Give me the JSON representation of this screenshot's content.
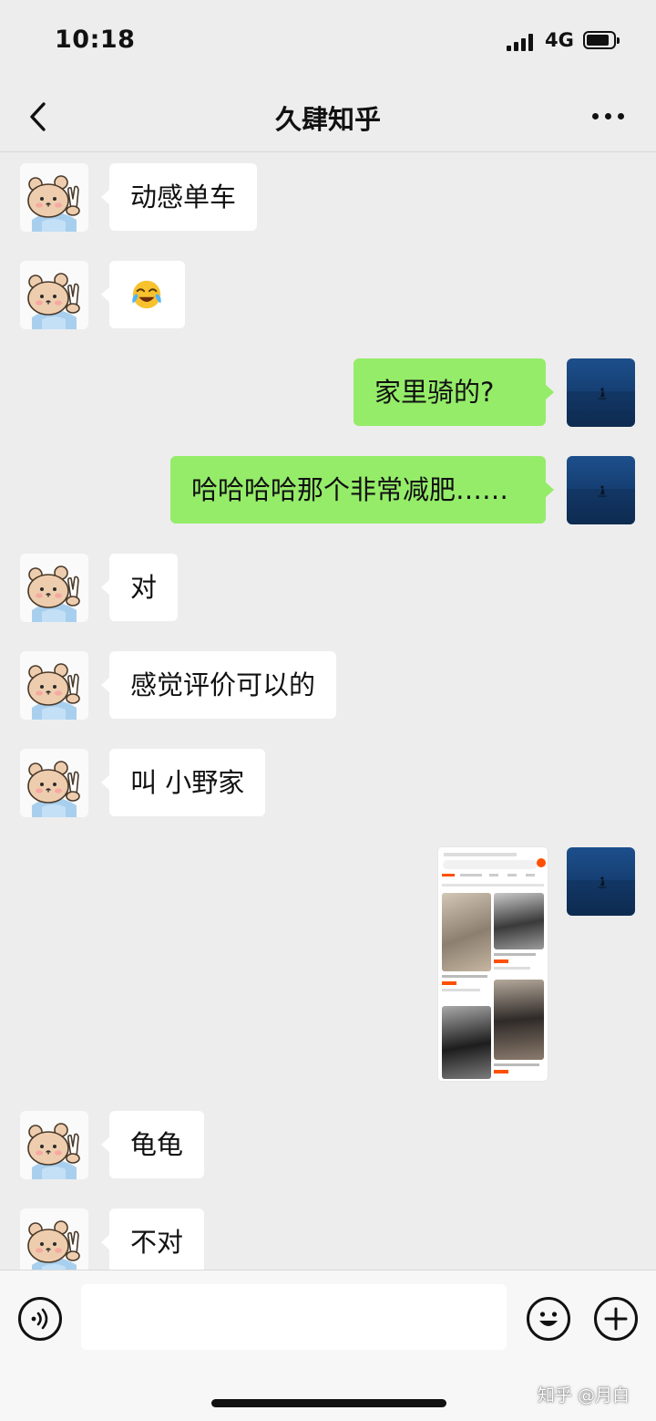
{
  "status_bar": {
    "time": "10:18",
    "network": "4G"
  },
  "header": {
    "title": "久肆知乎"
  },
  "messages": [
    {
      "side": "in",
      "type": "text",
      "text": "动感单车"
    },
    {
      "side": "in",
      "type": "emoji",
      "emoji": "face-with-tears-of-joy-icon"
    },
    {
      "side": "out",
      "type": "text",
      "text": "家里骑的?"
    },
    {
      "side": "out",
      "type": "text",
      "text": "哈哈哈哈那个非常减肥……"
    },
    {
      "side": "in",
      "type": "text",
      "text": "对"
    },
    {
      "side": "in",
      "type": "text",
      "text": "感觉评价可以的"
    },
    {
      "side": "in",
      "type": "text",
      "text": "叫 小野家"
    },
    {
      "side": "out",
      "type": "image"
    },
    {
      "side": "in",
      "type": "text",
      "text": "龟龟"
    },
    {
      "side": "in",
      "type": "text",
      "text": "不对"
    }
  ],
  "input_bar": {
    "text_value": ""
  },
  "watermark": "知乎 @月白",
  "colors": {
    "bubble_out": "#95ec69",
    "bubble_in": "#ffffff",
    "background": "#ededed",
    "shot_accent": "#ff5000"
  }
}
